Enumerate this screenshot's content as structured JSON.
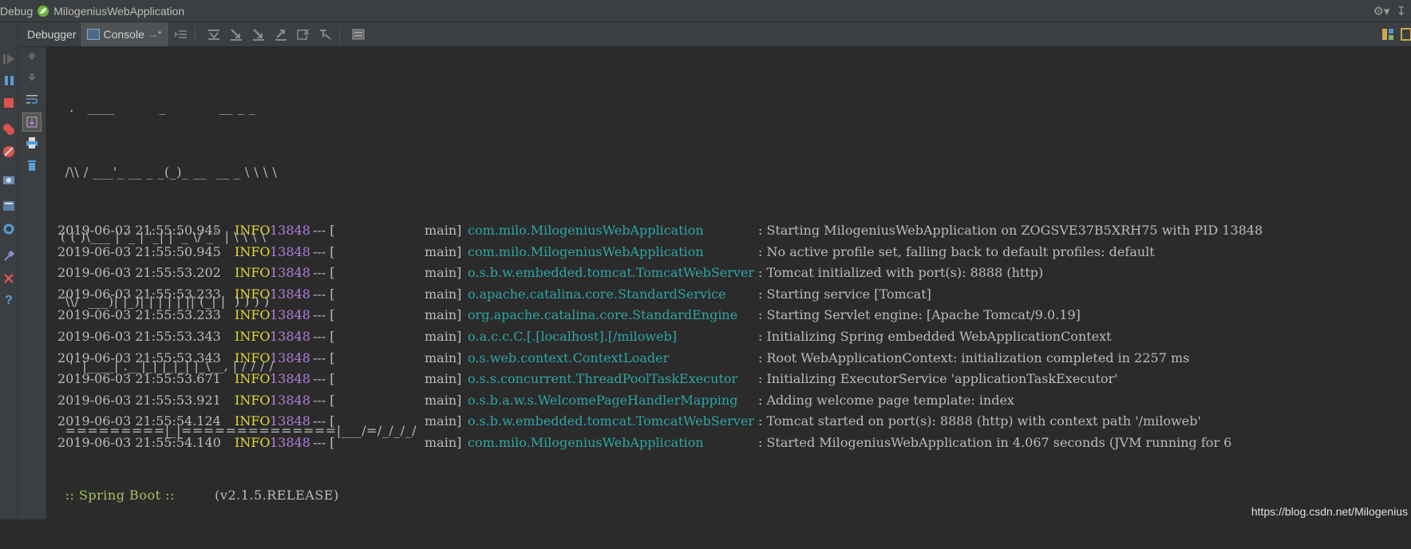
{
  "window": {
    "debug_label": "Debug",
    "app_name": "MilogeniusWebApplication"
  },
  "toolbar": {
    "debugger_tab": "Debugger",
    "console_tab": "Console",
    "console_suffix": "→*"
  },
  "banner": {
    "lines": [
      "  .   ____          _            __ _ _",
      " /\\\\ / ___'_ __ _ _(_)_ __  __ _ \\ \\ \\ \\",
      "( ( )\\___ | '_ | '_| | '_ \\/ _` | \\ \\ \\ \\",
      " \\\\/  ___)| |_)| | | | | || (_| |  ) ) ) )",
      "  '  |____| .__|_| |_|_| |_\\__, | / / / /",
      " =========|_|==============|___/=/_/_/_/"
    ],
    "boot_label": " :: Spring Boot :: ",
    "version": "(v2.1.5.RELEASE)"
  },
  "logs": [
    {
      "ts": "2019-06-03 21:55:50.945",
      "level": "INFO",
      "pid": "13848",
      "sep": "--- [",
      "thread": "main]",
      "logger": "com.milo.MilogeniusWebApplication",
      "msg": ": Starting MilogeniusWebApplication on ZOGSVE37B5XRH75 with PID 13848"
    },
    {
      "ts": "2019-06-03 21:55:50.945",
      "level": "INFO",
      "pid": "13848",
      "sep": "--- [",
      "thread": "main]",
      "logger": "com.milo.MilogeniusWebApplication",
      "msg": ": No active profile set, falling back to default profiles: default"
    },
    {
      "ts": "2019-06-03 21:55:53.202",
      "level": "INFO",
      "pid": "13848",
      "sep": "--- [",
      "thread": "main]",
      "logger": "o.s.b.w.embedded.tomcat.TomcatWebServer",
      "msg": ": Tomcat initialized with port(s): 8888 (http)"
    },
    {
      "ts": "2019-06-03 21:55:53.233",
      "level": "INFO",
      "pid": "13848",
      "sep": "--- [",
      "thread": "main]",
      "logger": "o.apache.catalina.core.StandardService",
      "msg": ": Starting service [Tomcat]"
    },
    {
      "ts": "2019-06-03 21:55:53.233",
      "level": "INFO",
      "pid": "13848",
      "sep": "--- [",
      "thread": "main]",
      "logger": "org.apache.catalina.core.StandardEngine",
      "msg": ": Starting Servlet engine: [Apache Tomcat/9.0.19]"
    },
    {
      "ts": "2019-06-03 21:55:53.343",
      "level": "INFO",
      "pid": "13848",
      "sep": "--- [",
      "thread": "main]",
      "logger": "o.a.c.c.C.[.[localhost].[/miloweb]",
      "msg": ": Initializing Spring embedded WebApplicationContext"
    },
    {
      "ts": "2019-06-03 21:55:53.343",
      "level": "INFO",
      "pid": "13848",
      "sep": "--- [",
      "thread": "main]",
      "logger": "o.s.web.context.ContextLoader",
      "msg": ": Root WebApplicationContext: initialization completed in 2257 ms"
    },
    {
      "ts": "2019-06-03 21:55:53.671",
      "level": "INFO",
      "pid": "13848",
      "sep": "--- [",
      "thread": "main]",
      "logger": "o.s.s.concurrent.ThreadPoolTaskExecutor",
      "msg": ": Initializing ExecutorService 'applicationTaskExecutor'"
    },
    {
      "ts": "2019-06-03 21:55:53.921",
      "level": "INFO",
      "pid": "13848",
      "sep": "--- [",
      "thread": "main]",
      "logger": "o.s.b.a.w.s.WelcomePageHandlerMapping",
      "msg": ": Adding welcome page template: index"
    },
    {
      "ts": "2019-06-03 21:55:54.124",
      "level": "INFO",
      "pid": "13848",
      "sep": "--- [",
      "thread": "main]",
      "logger": "o.s.b.w.embedded.tomcat.TomcatWebServer",
      "msg": ": Tomcat started on port(s): 8888 (http) with context path '/miloweb'"
    },
    {
      "ts": "2019-06-03 21:55:54.140",
      "level": "INFO",
      "pid": "13848",
      "sep": "--- [",
      "thread": "main]",
      "logger": "com.milo.MilogeniusWebApplication",
      "msg": ": Started MilogeniusWebApplication in 4.067 seconds (JVM running for 6"
    }
  ],
  "watermark": "https://blog.csdn.net/Milogenius"
}
